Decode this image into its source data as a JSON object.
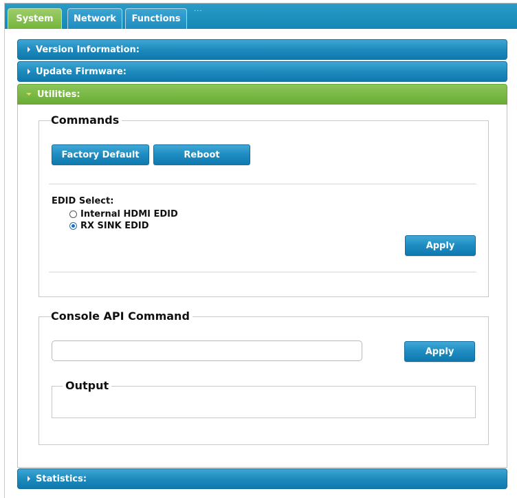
{
  "tabs": [
    {
      "label": "System",
      "active": true
    },
    {
      "label": "Network",
      "active": false
    },
    {
      "label": "Functions",
      "active": false
    }
  ],
  "tab_overflow": "...",
  "accordion": {
    "version_info": "Version Information:",
    "update_firmware": "Update Firmware:",
    "utilities": "Utilities:",
    "statistics": "Statistics:"
  },
  "commands": {
    "legend": "Commands",
    "factory_default": "Factory Default",
    "reboot": "Reboot",
    "edid_label": "EDID Select:",
    "edid_options": [
      {
        "label": "Internal HDMI EDID",
        "checked": false
      },
      {
        "label": "RX SINK EDID",
        "checked": true
      }
    ],
    "apply": "Apply"
  },
  "console": {
    "legend": "Console API Command",
    "input_value": "",
    "apply": "Apply",
    "output_legend": "Output"
  },
  "colors": {
    "tab_bar": "#1588b6",
    "active_tab": "#74b43b",
    "header_blue": "#1b88bc",
    "header_green": "#78b844"
  }
}
